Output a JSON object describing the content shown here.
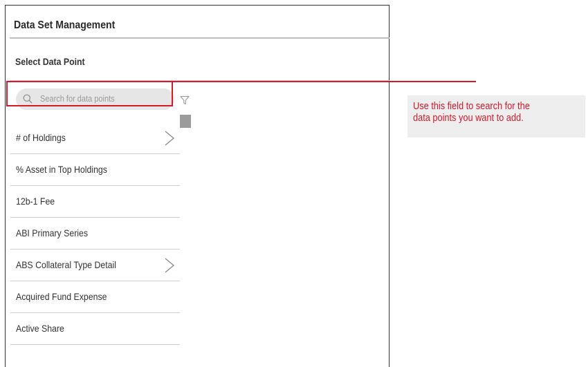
{
  "panel": {
    "title": "Data Set Management",
    "subtitle": "Select Data Point"
  },
  "search": {
    "placeholder": "Search for data points",
    "icon": "magnifier"
  },
  "filter": {
    "icon": "funnel"
  },
  "data_points": [
    {
      "label": "# of Holdings",
      "has_submenu": true
    },
    {
      "label": "% Asset in Top Holdings",
      "has_submenu": false
    },
    {
      "label": "12b-1 Fee",
      "has_submenu": false
    },
    {
      "label": "ABI Primary Series",
      "has_submenu": false
    },
    {
      "label": "ABS Collateral Type Detail",
      "has_submenu": true
    },
    {
      "label": "Acquired Fund Expense",
      "has_submenu": false
    },
    {
      "label": "Active Share",
      "has_submenu": false
    }
  ],
  "callout": {
    "line1": "Use this field to search for the",
    "line2": "data points you want to add."
  },
  "colors": {
    "annotation_red": "#d7182a",
    "search_background": "#e6e6e6",
    "callout_background": "#eeeeee"
  }
}
